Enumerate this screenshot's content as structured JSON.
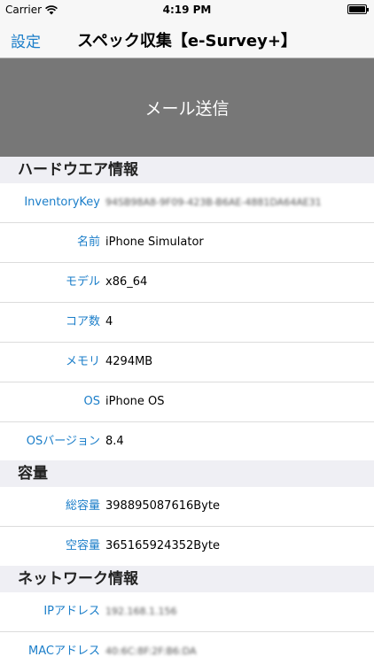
{
  "status_bar": {
    "carrier": "Carrier",
    "time": "4:19 PM"
  },
  "nav": {
    "back_label": "設定",
    "title": "スペック収集【e-Survey+】"
  },
  "send_mail_label": "メール送信",
  "sections": {
    "hardware": {
      "title": "ハードウエア情報",
      "rows": [
        {
          "label": "InventoryKey",
          "value": "94SB98A8-9F09-423B-B6AE-4881DA64AE31"
        },
        {
          "label": "名前",
          "value": "iPhone Simulator"
        },
        {
          "label": "モデル",
          "value": "x86_64"
        },
        {
          "label": "コア数",
          "value": "4"
        },
        {
          "label": "メモリ",
          "value": "4294MB"
        },
        {
          "label": "OS",
          "value": "iPhone OS"
        },
        {
          "label": "OSバージョン",
          "value": "8.4"
        }
      ]
    },
    "capacity": {
      "title": "容量",
      "rows": [
        {
          "label": "総容量",
          "value": "398895087616Byte"
        },
        {
          "label": "空容量",
          "value": "365165924352Byte"
        }
      ]
    },
    "network": {
      "title": "ネットワーク情報",
      "rows": [
        {
          "label": "IPアドレス",
          "value": "192.168.1.156"
        },
        {
          "label": "MACアドレス",
          "value": "40:6C:8F:2F:B6:DA"
        }
      ]
    }
  },
  "colors": {
    "accent": "#1b7ec9",
    "send_button_bg": "#777777",
    "background": "#efeff4"
  }
}
